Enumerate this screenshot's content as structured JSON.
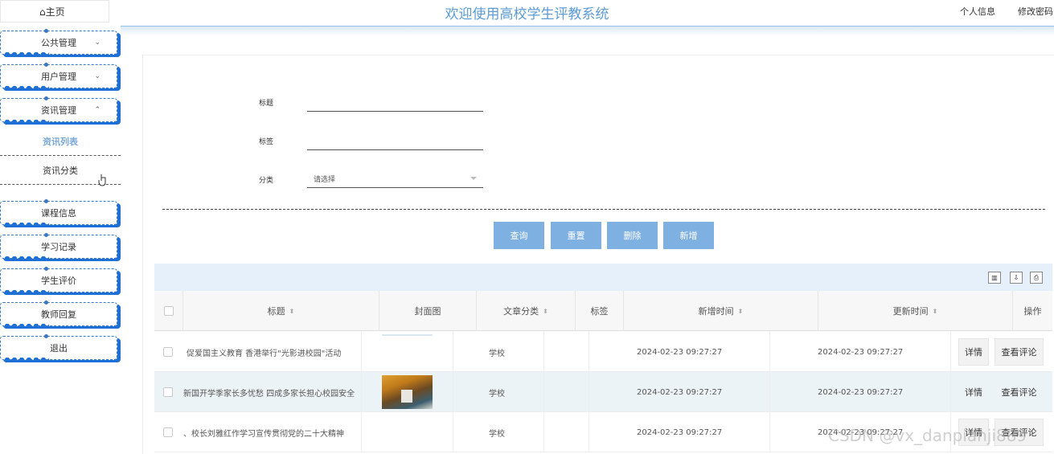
{
  "header": {
    "home_tab": "⌂主页",
    "title": "欢迎使用高校学生评教系统",
    "profile_link": "个人信息",
    "password_link": "修改密码"
  },
  "sidebar": {
    "menus": [
      {
        "label": "公共管理",
        "chevron": "⌄"
      },
      {
        "label": "用户管理",
        "chevron": "⌄"
      },
      {
        "label": "资讯管理",
        "chevron": "⌃"
      },
      {
        "label": "课程信息"
      },
      {
        "label": "学习记录"
      },
      {
        "label": "学生评价"
      },
      {
        "label": "教师回复"
      },
      {
        "label": "退出"
      }
    ],
    "submenus": [
      {
        "label": "资讯列表",
        "active": true
      },
      {
        "label": "资讯分类",
        "active": false
      }
    ]
  },
  "search": {
    "title_label": "标题",
    "title_value": "",
    "tag_label": "标签",
    "tag_value": "",
    "category_label": "分类",
    "category_placeholder": "请选择"
  },
  "buttons": {
    "query": "查询",
    "reset": "重置",
    "delete": "删除",
    "add": "新增"
  },
  "table": {
    "columns": [
      "标题",
      "封面图",
      "文章分类",
      "标签",
      "新增时间",
      "更新时间",
      "操作"
    ],
    "rows": [
      {
        "title": "促爱国主义教育 香港举行\"光影进校园\"活动",
        "category": "学校",
        "tag": "",
        "created": "2024-02-23 09:27:27",
        "updated": "2024-02-23 09:27:27",
        "has_cover": false
      },
      {
        "title": "新国开学季家长多忧愁 四成多家长担心校园安全",
        "category": "学校",
        "tag": "",
        "created": "2024-02-23 09:27:27",
        "updated": "2024-02-23 09:27:27",
        "has_cover": true
      },
      {
        "title": "、校长刘雅红作学习宣传贯彻党的二十大精神",
        "category": "学校",
        "tag": "",
        "created": "2024-02-23 09:27:27",
        "updated": "2024-02-23 09:27:27",
        "has_cover": false
      }
    ],
    "detail_label": "详情",
    "comments_label": "查看评论"
  },
  "watermark": "CSDN @vx_danpianji889",
  "colors": {
    "accent": "#7fb0e2",
    "title": "#5c9bd6",
    "menu_shadow": "#1e6fd6"
  }
}
